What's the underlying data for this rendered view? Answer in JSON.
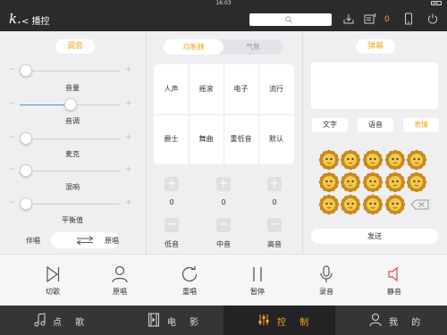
{
  "status": {
    "time": "16:03"
  },
  "header": {
    "logo": "k.",
    "back_label": "< 播控",
    "count": "0"
  },
  "tuning": {
    "title": "调音",
    "sliders": [
      {
        "label": "音量",
        "value": 0.05
      },
      {
        "label": "音调",
        "value": 0.5
      },
      {
        "label": "麦克",
        "value": 0.05
      },
      {
        "label": "混响",
        "value": 0.05
      },
      {
        "label": "平衡值",
        "value": 0.05
      }
    ],
    "left_label": "伴唱",
    "right_label": "原唱"
  },
  "equalizer": {
    "tab_active": "均衡器",
    "tab_other": "气氛",
    "presets": [
      "人声",
      "摇滚",
      "电子",
      "流行",
      "爵士",
      "舞曲",
      "重低音",
      "默认"
    ],
    "bands": [
      {
        "label": "低音",
        "value": "0"
      },
      {
        "label": "中音",
        "value": "0"
      },
      {
        "label": "高音",
        "value": "0"
      }
    ],
    "plus": "+",
    "minus": "−"
  },
  "danmu": {
    "title": "弹幕",
    "tabs": [
      "文字",
      "语音",
      "表情"
    ],
    "active_tab": "表情",
    "send": "发送"
  },
  "controls": [
    {
      "label": "切歌",
      "icon": "skip-icon"
    },
    {
      "label": "原唱",
      "icon": "person-icon"
    },
    {
      "label": "重唱",
      "icon": "replay-icon"
    },
    {
      "label": "暂停",
      "icon": "pause-icon"
    },
    {
      "label": "录音",
      "icon": "mic-icon"
    },
    {
      "label": "静音",
      "icon": "speaker-icon"
    }
  ],
  "nav": [
    {
      "label": "点 歌",
      "icon": "music-note-icon"
    },
    {
      "label": "电 影",
      "icon": "film-icon"
    },
    {
      "label": "控 制",
      "icon": "equalizer-icon"
    },
    {
      "label": "我 的",
      "icon": "user-icon"
    }
  ],
  "colors": {
    "accent": "#f5a623",
    "header_bg": "#2b2b2d",
    "nav_bg": "#353537",
    "slider_fill": "#4a8fe0"
  }
}
